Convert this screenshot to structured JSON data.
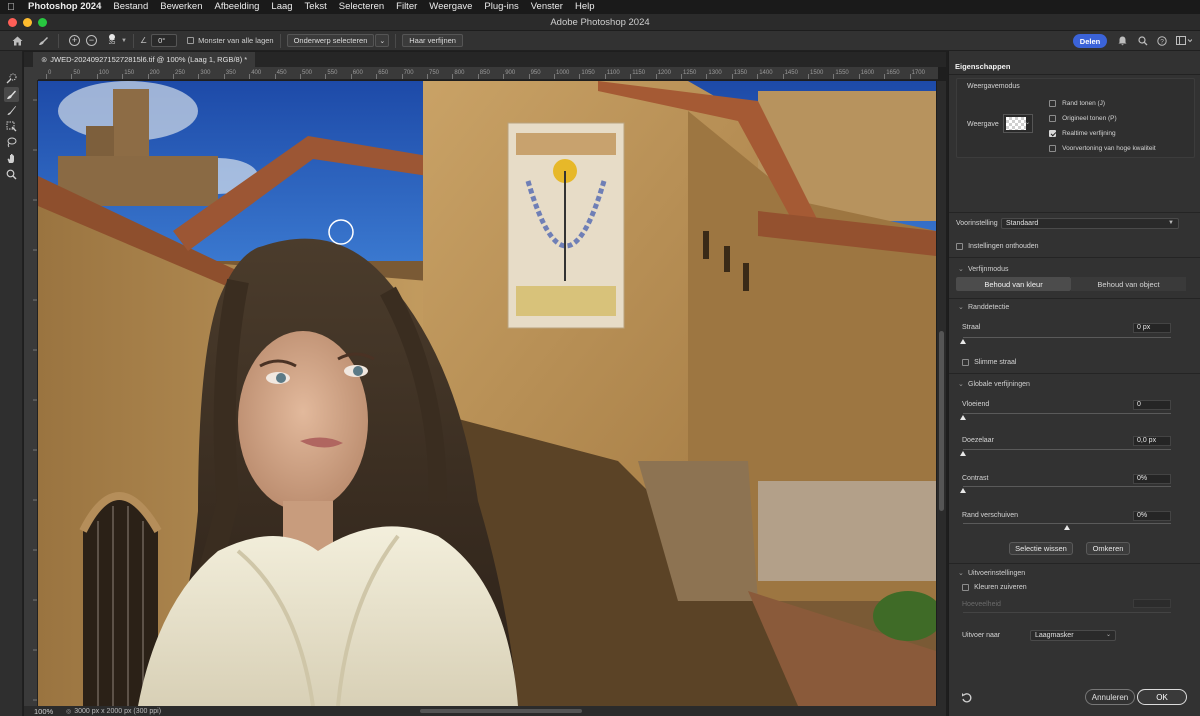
{
  "menubar": {
    "apple_icon": "apple-logo",
    "items": [
      "Photoshop 2024",
      "Bestand",
      "Bewerken",
      "Afbeelding",
      "Laag",
      "Tekst",
      "Selecteren",
      "Filter",
      "Weergave",
      "Plug-ins",
      "Venster",
      "Help"
    ]
  },
  "window": {
    "title": "Adobe Photoshop 2024"
  },
  "options": {
    "brush_size": "35",
    "angle": "0°",
    "sample_all_layers": "Monster van alle lagen",
    "select_subject": "Onderwerp selecteren",
    "refine_hair": "Haar verfijnen",
    "share": "Delen"
  },
  "document": {
    "tab_title": "JWED-2024092715272815l6.tif @ 100% (Laag 1, RGB/8) *",
    "ruler_ticks": [
      "0",
      "50",
      "100",
      "150",
      "200",
      "250",
      "300",
      "350",
      "400",
      "450",
      "500",
      "550",
      "600",
      "650",
      "700",
      "750",
      "800",
      "850",
      "900",
      "950",
      "1000",
      "1050",
      "1100",
      "1150",
      "1200",
      "1250",
      "1300",
      "1350",
      "1400",
      "1450",
      "1500",
      "1550",
      "1600",
      "1650",
      "1700",
      "1750"
    ],
    "zoom": "100%",
    "doc_info": "3000 px x 2000 px (300 ppi)"
  },
  "panel": {
    "title": "Eigenschappen",
    "view_mode": {
      "heading": "Weergavemodus",
      "view_label": "Weergave",
      "opt_edges": "Rand tonen (J)",
      "opt_original": "Origineel tonen (P)",
      "opt_realtime": "Realtime verfijning",
      "opt_hq": "Voorvertoning van hoge kwaliteit",
      "realtime_checked": true
    },
    "preset": {
      "label": "Voorinstelling",
      "value": "Standaard"
    },
    "remember": "Instellingen onthouden",
    "refine_mode": {
      "heading": "Verfijnmodus",
      "color_aware": "Behoud van kleur",
      "object_aware": "Behoud van object"
    },
    "edge_detection": {
      "heading": "Randdetectie",
      "radius_label": "Straal",
      "radius_value": "0 px",
      "radius_level": 0,
      "smart_radius": "Slimme straal"
    },
    "global": {
      "heading": "Globale verfijningen",
      "smooth_label": "Vloeiend",
      "smooth_value": "0",
      "smooth_level": 0,
      "feather_label": "Doezelaar",
      "feather_value": "0,0 px",
      "feather_level": 0,
      "contrast_label": "Contrast",
      "contrast_value": "0%",
      "contrast_level": 0,
      "shift_label": "Rand verschuiven",
      "shift_value": "0%",
      "shift_level": 0.5,
      "clear_btn": "Selectie wissen",
      "invert_btn": "Omkeren"
    },
    "output": {
      "heading": "Uitvoerinstellingen",
      "decontaminate": "Kleuren zuiveren",
      "amount_label": "Hoeveelheid",
      "output_label": "Uitvoer naar",
      "output_value": "Laagmasker"
    },
    "cancel": "Annuleren",
    "ok": "OK"
  }
}
